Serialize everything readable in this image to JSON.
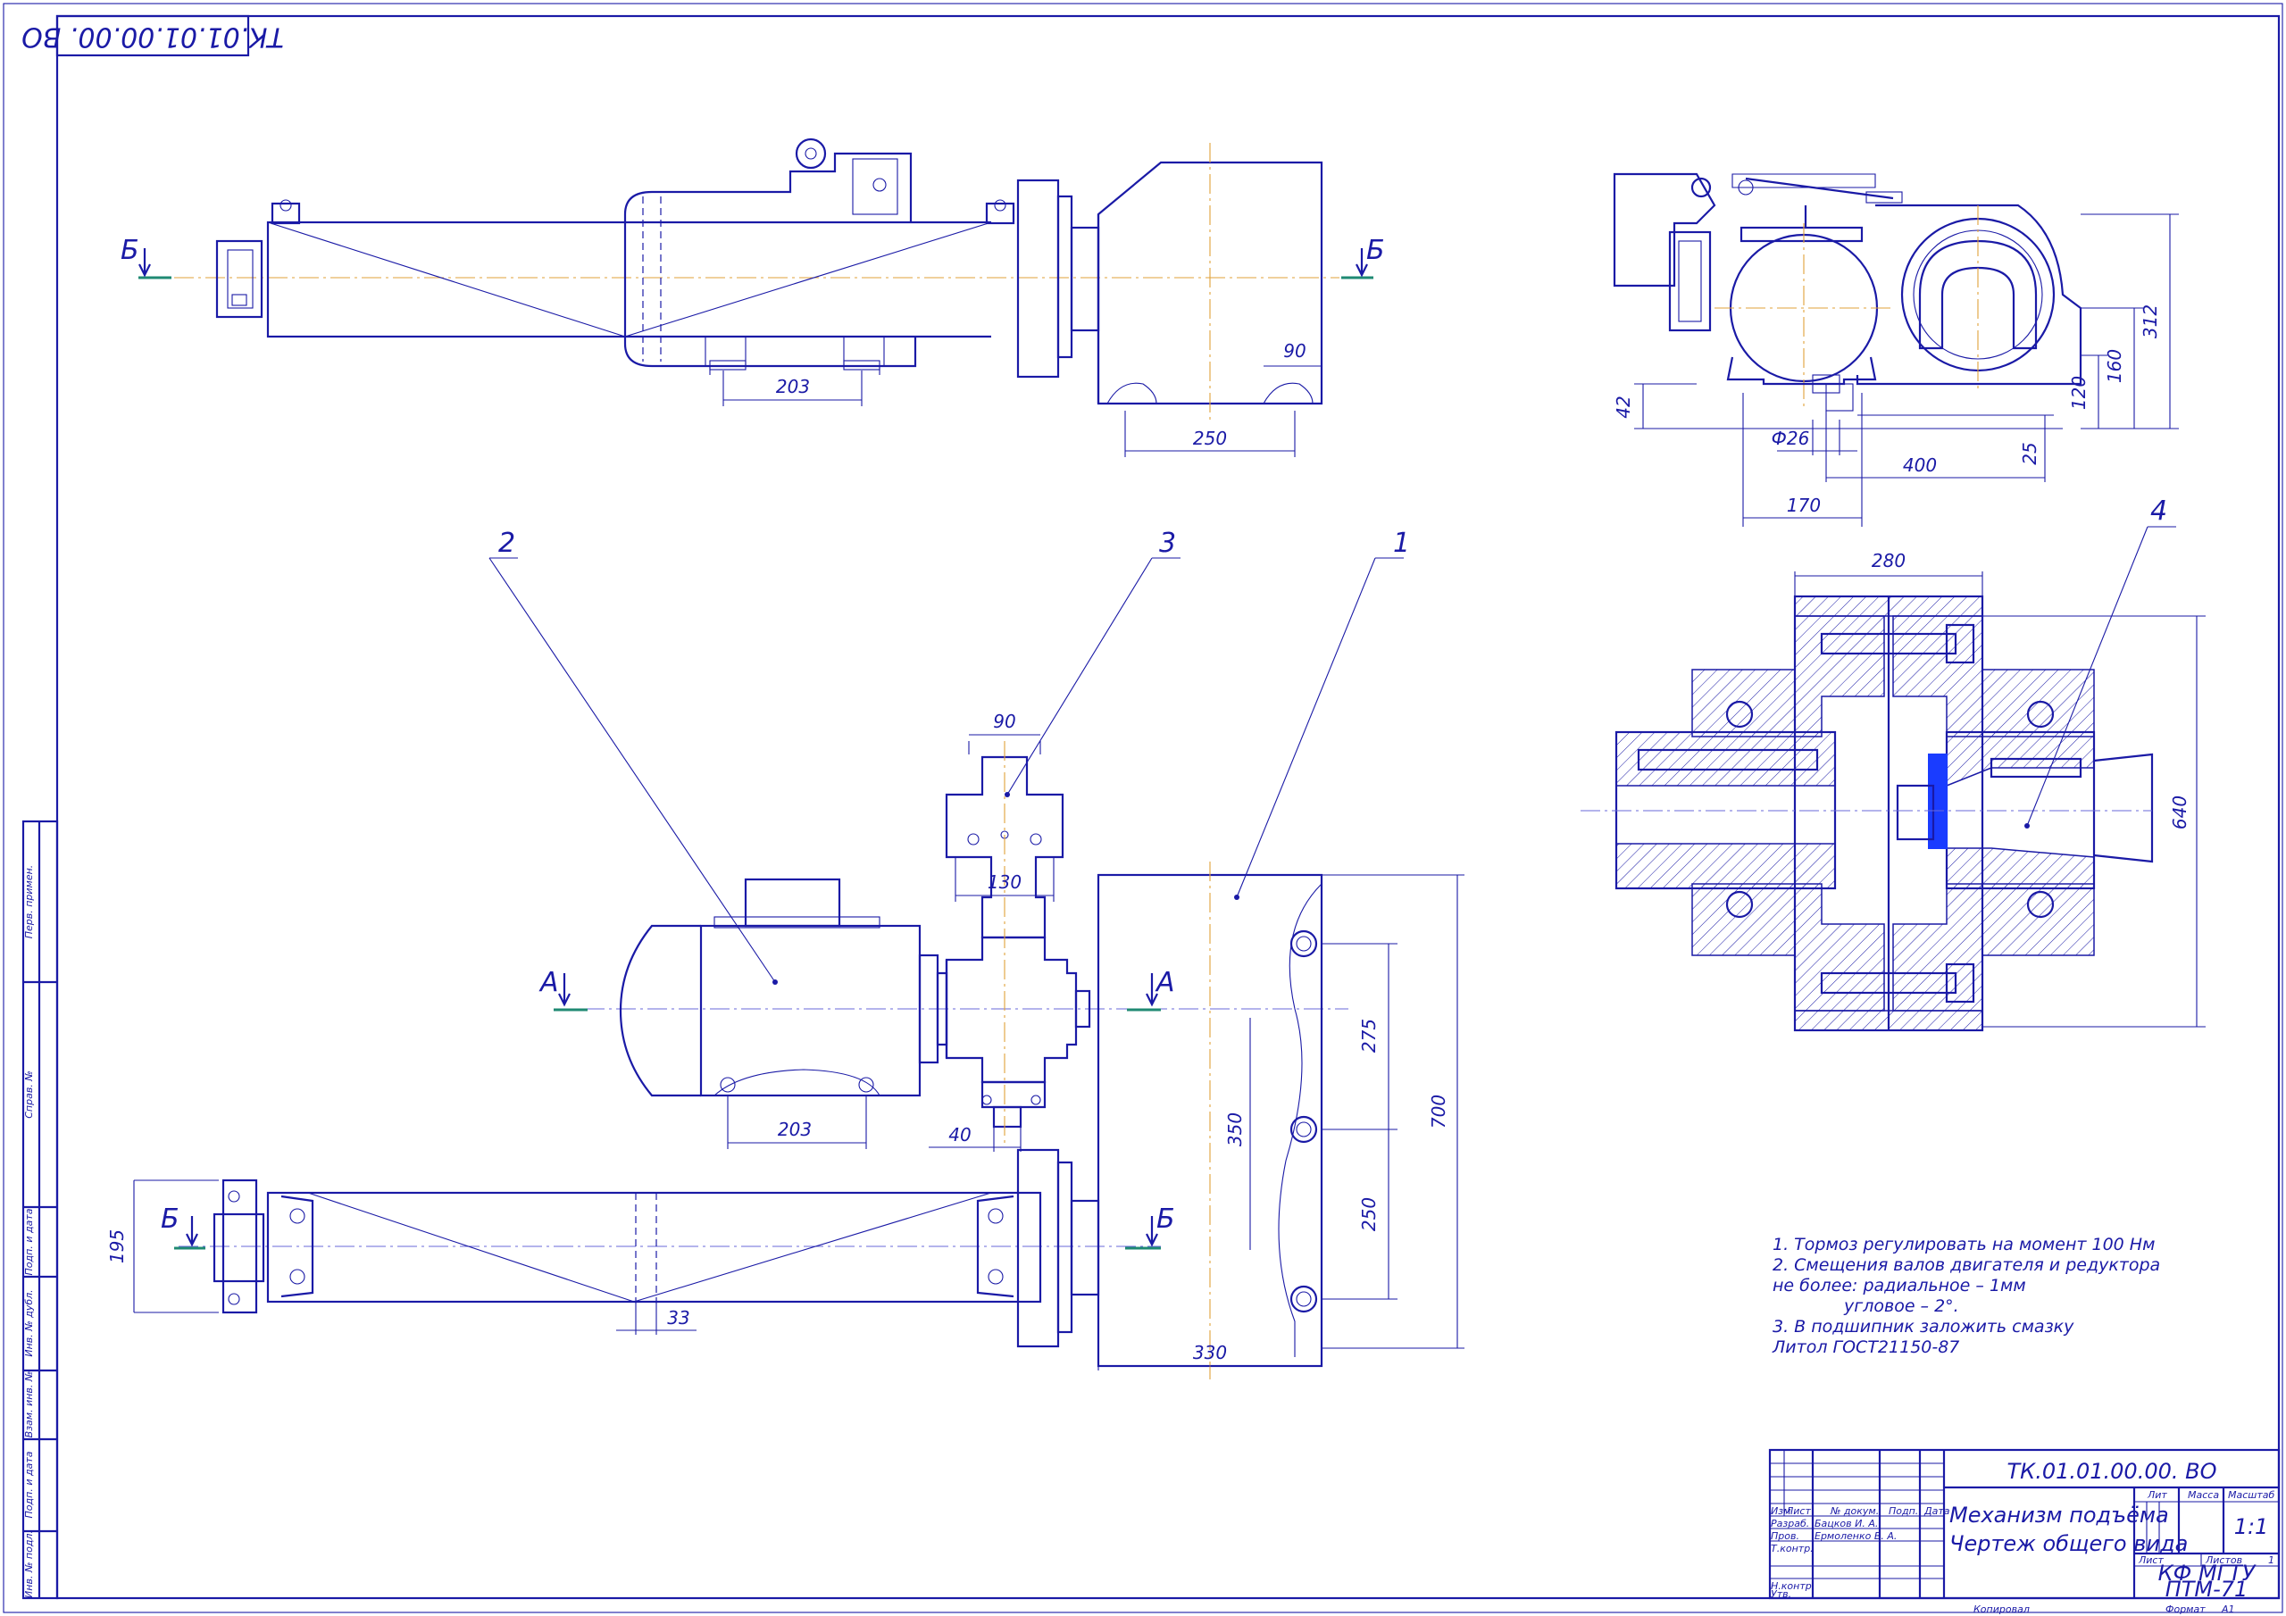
{
  "drawing_code": "ТК.01.01.00.00. ВО",
  "drawing_code_stamp": "ТК.01.01.00.00. ВО",
  "title": "Механизм подъёма",
  "subtitle": "Чертеж общего вида",
  "organization": "КФ МГТУ",
  "group": "ПТМ-71",
  "scale": "1:1",
  "sheet": "1",
  "sheets_label": "Листов",
  "sheets_count": "1",
  "lit_label": "Лит",
  "mass_label": "Масса",
  "scale_label": "Масштаб",
  "sheet_label": "Лист",
  "format_label": "Формат",
  "format": "А1",
  "copied_label": "Копировал",
  "stamp_columns": [
    "Изм",
    "Лист",
    "№ докум.",
    "Подп.",
    "Дата"
  ],
  "stamp_rows": [
    {
      "role": "Разраб.",
      "name": "Бацков И. А."
    },
    {
      "role": "Пров.",
      "name": "Ермоленко В. А."
    },
    {
      "role": "Т.контр.",
      "name": ""
    },
    {
      "role": "",
      "name": ""
    },
    {
      "role": "Н.контр.",
      "name": ""
    },
    {
      "role": "Утв.",
      "name": ""
    }
  ],
  "side_stamps": [
    "Перв. примен.",
    "Справ. №",
    "Подп. и дата",
    "Инв. № дубл.",
    "Взам. инв. №",
    "Подп. и дата",
    "Инв. № подл."
  ],
  "section_labels": {
    "a": "А",
    "b": "Б"
  },
  "part_labels": [
    "1",
    "2",
    "3",
    "4"
  ],
  "notes": [
    "1. Тормоз регулировать на момент 100 Нм",
    "2. Смещения валов двигателя и редуктора",
    "не более: радиальное – 1мм",
    "угловое – 2°.",
    "3. В подшипник заложить смазку",
    "Литол ГОСТ21150-87"
  ],
  "dimensions": {
    "top_203": "203",
    "top_90": "90",
    "top_250": "250",
    "right_312": "312",
    "right_160": "160",
    "right_120": "120",
    "right_42": "42",
    "right_25": "25",
    "right_d26": "Ф26",
    "right_400": "400",
    "right_170": "170",
    "cpl_280": "280",
    "cpl_640": "640",
    "mid_90": "90",
    "mid_130": "130",
    "mid_203": "203",
    "mid_40": "40",
    "mid_275": "275",
    "mid_350": "350",
    "mid_250": "250",
    "mid_700": "700",
    "mid_330": "330",
    "bot_195": "195",
    "bot_33": "33"
  },
  "colors": {
    "line": "#1a1aa6",
    "axis": "#e0a13a",
    "section": "#1f8a73",
    "accent": "#1a3cff"
  }
}
